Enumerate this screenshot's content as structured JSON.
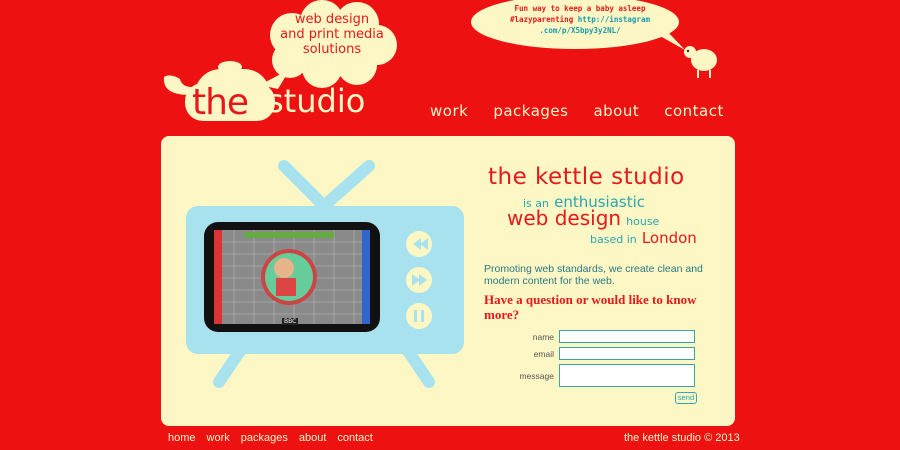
{
  "cloud": {
    "line1": "web design",
    "line2": "and print media",
    "line3": "solutions"
  },
  "tweet": {
    "text1": "Fun way to keep a baby asleep",
    "text2": "#lazyparenting",
    "link1": "http://instagram",
    "link2": ".com/p/X5bpy3y2NL/"
  },
  "logo": {
    "the": "the",
    "studio": "studio"
  },
  "nav": {
    "items": [
      "work",
      "packages",
      "about",
      "contact"
    ]
  },
  "tv": {
    "screen_label": "BBC"
  },
  "headline": {
    "title": "the kettle studio",
    "l2a": "is an",
    "l2b": "enthusiastic",
    "l3a": "web design",
    "l3b": "house",
    "l4a": "based in",
    "l4b": "London"
  },
  "promo": "Promoting web standards, we create clean and modern content for the web.",
  "question": "Have a question or would like to know more?",
  "form": {
    "name_label": "name",
    "email_label": "email",
    "message_label": "message",
    "send_label": "send"
  },
  "footer": {
    "items": [
      "home",
      "work",
      "packages",
      "about",
      "contact"
    ],
    "copyright": "the kettle studio © 2013"
  },
  "colors": {
    "background": "#ee1111",
    "cream": "#fdf7c6",
    "teal": "#2aa6b0",
    "tv_blue": "#a8e2ee",
    "accent_red": "#e8181a"
  }
}
